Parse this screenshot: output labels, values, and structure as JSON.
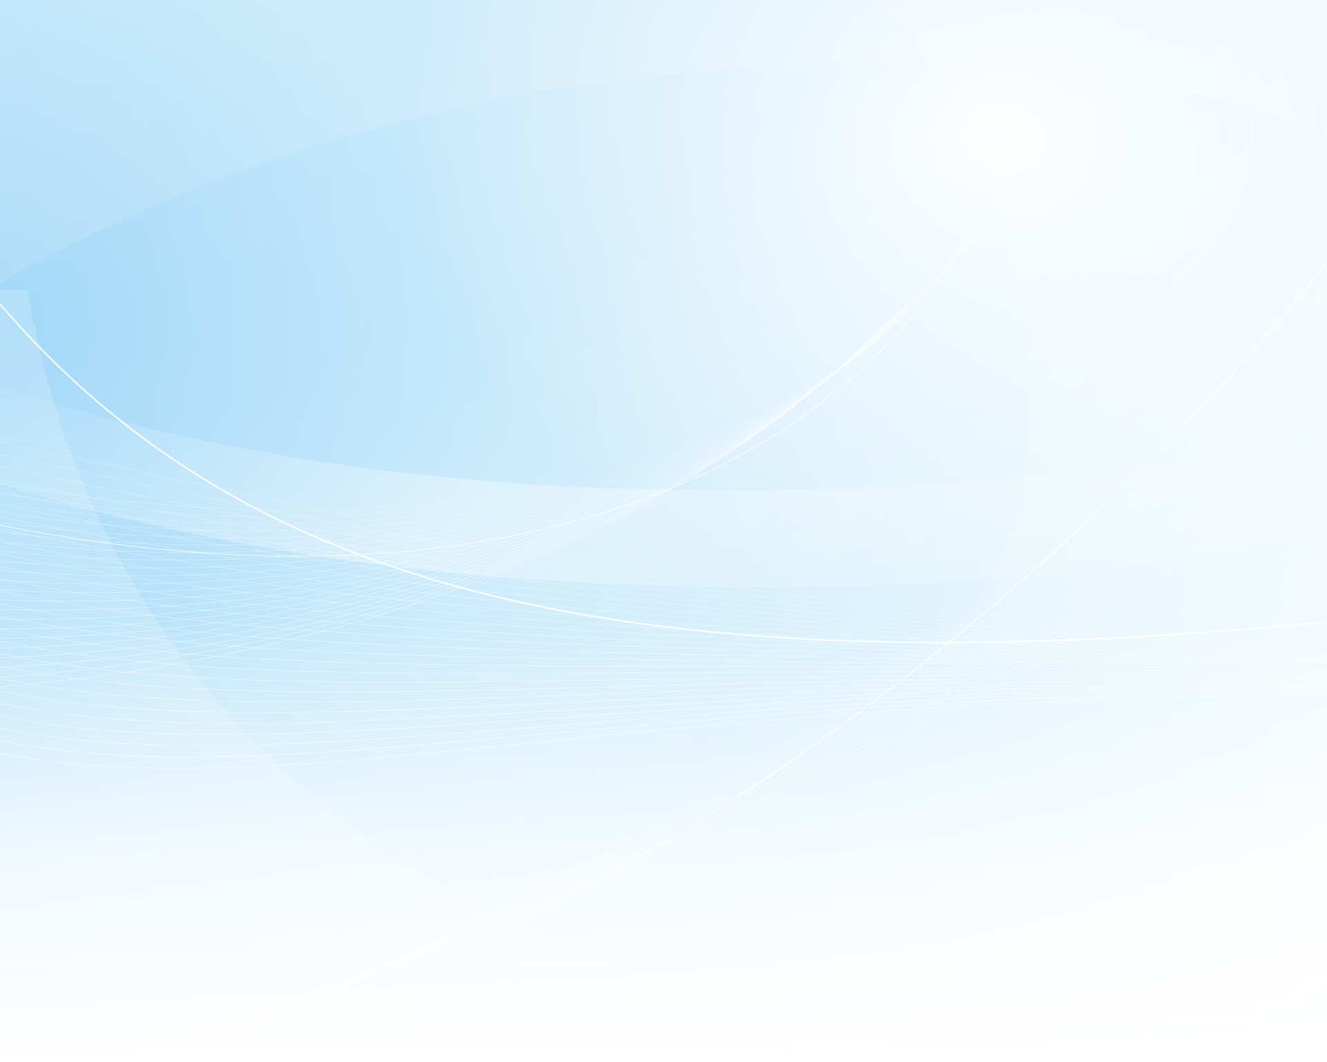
{
  "palette": {
    "sky_deep": "#a9dcf8",
    "sky_mid": "#c9ebfb",
    "sky_light": "#e4f6fd",
    "glow": "#ffffff",
    "line": "#ffffff",
    "bottom_fade": "#ffffff"
  },
  "decor": {
    "style": "abstract-wave-background",
    "text_present": false
  }
}
